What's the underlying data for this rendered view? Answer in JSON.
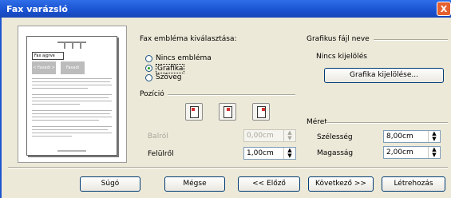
{
  "window": {
    "title": "Fax varázsló",
    "close_glyph": "X"
  },
  "preview": {
    "fax_label": "Fax ajgrve",
    "block_left": "< Faxadi >",
    "block_right": "Faxadi"
  },
  "emblem": {
    "heading": "Fax embléma kiválasztása:",
    "options": [
      {
        "label": "Nincs embléma",
        "selected": false
      },
      {
        "label": "Grafika",
        "selected": true
      },
      {
        "label": "Szöveg",
        "selected": false
      }
    ]
  },
  "position": {
    "heading": "Pozíció",
    "buttons": [
      "position-left-icon",
      "position-center-icon",
      "position-right-icon"
    ],
    "from_left_label": "Balról",
    "from_left_value": "0,00cm",
    "from_top_label": "Felülről",
    "from_top_value": "1,00cm"
  },
  "graphic_file": {
    "heading": "Grafikus fájl neve",
    "status": "Nincs kijelölés",
    "select_button": "Grafika kijelölése..."
  },
  "size": {
    "heading": "Méret",
    "width_label": "Szélesség",
    "width_value": "8,00cm",
    "height_label": "Magasság",
    "height_value": "2,00cm"
  },
  "footer": {
    "help": "Súgó",
    "cancel": "Mégse",
    "previous": "<< Előző",
    "next": "Következő >>",
    "create": "Létrehozás"
  },
  "colors": {
    "titlebar": "#1a52d0",
    "close": "#e4602e",
    "dialog_bg": "#ece9d8",
    "radio_dot": "#21a121"
  }
}
